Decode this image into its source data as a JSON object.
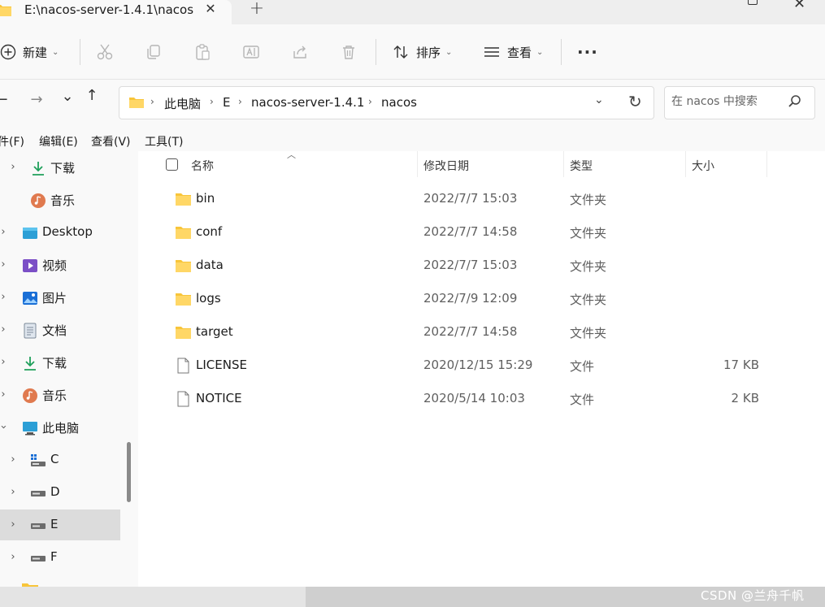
{
  "window": {
    "tab_title": "E:\\nacos-server-1.4.1\\nacos",
    "tab_close": "✕",
    "new_tab": "+",
    "window_close": "✕"
  },
  "toolbar": {
    "new_label": "新建",
    "sort_label": "排序",
    "view_label": "查看",
    "more_label": "···"
  },
  "nav": {
    "back": "←",
    "forward": "→",
    "recent": "⌄",
    "up": "↑"
  },
  "address": {
    "crumbs": [
      "此电脑",
      "E",
      "nacos-server-1.4.1",
      "nacos"
    ],
    "separator": "›"
  },
  "search": {
    "placeholder": "在 nacos 中搜索"
  },
  "menubar": {
    "items": [
      "件(F)",
      "编辑(E)",
      "查看(V)",
      "工具(T)"
    ]
  },
  "sidebar": {
    "items": [
      {
        "label": "下载",
        "icon": "download-icon"
      },
      {
        "label": "音乐",
        "icon": "music-icon"
      },
      {
        "label": "Desktop",
        "icon": "desktop-icon"
      },
      {
        "label": "视频",
        "icon": "video-icon"
      },
      {
        "label": "图片",
        "icon": "pictures-icon"
      },
      {
        "label": "文档",
        "icon": "documents-icon"
      },
      {
        "label": "下载",
        "icon": "download-icon"
      },
      {
        "label": "音乐",
        "icon": "music-icon"
      },
      {
        "label": "此电脑",
        "icon": "computer-icon"
      },
      {
        "label": "C",
        "icon": "windows-drive-icon"
      },
      {
        "label": "D",
        "icon": "drive-icon"
      },
      {
        "label": "E",
        "icon": "drive-icon"
      },
      {
        "label": "F",
        "icon": "drive-icon"
      }
    ],
    "selected": "E"
  },
  "columns": {
    "name": "名称",
    "date": "修改日期",
    "type": "类型",
    "size": "大小"
  },
  "files": [
    {
      "name": "bin",
      "date": "2022/7/7 15:03",
      "type": "文件夹",
      "size": "",
      "kind": "folder"
    },
    {
      "name": "conf",
      "date": "2022/7/7 14:58",
      "type": "文件夹",
      "size": "",
      "kind": "folder"
    },
    {
      "name": "data",
      "date": "2022/7/7 15:03",
      "type": "文件夹",
      "size": "",
      "kind": "folder"
    },
    {
      "name": "logs",
      "date": "2022/7/9 12:09",
      "type": "文件夹",
      "size": "",
      "kind": "folder"
    },
    {
      "name": "target",
      "date": "2022/7/7 14:58",
      "type": "文件夹",
      "size": "",
      "kind": "folder"
    },
    {
      "name": "LICENSE",
      "date": "2020/12/15 15:29",
      "type": "文件",
      "size": "17 KB",
      "kind": "file"
    },
    {
      "name": "NOTICE",
      "date": "2020/5/14 10:03",
      "type": "文件",
      "size": "2 KB",
      "kind": "file"
    }
  ],
  "watermark": "CSDN @兰舟千帆",
  "colors": {
    "folder": "#f8c53a",
    "accent": "#1a6fd6",
    "selected_bg": "#dcdcdc"
  }
}
